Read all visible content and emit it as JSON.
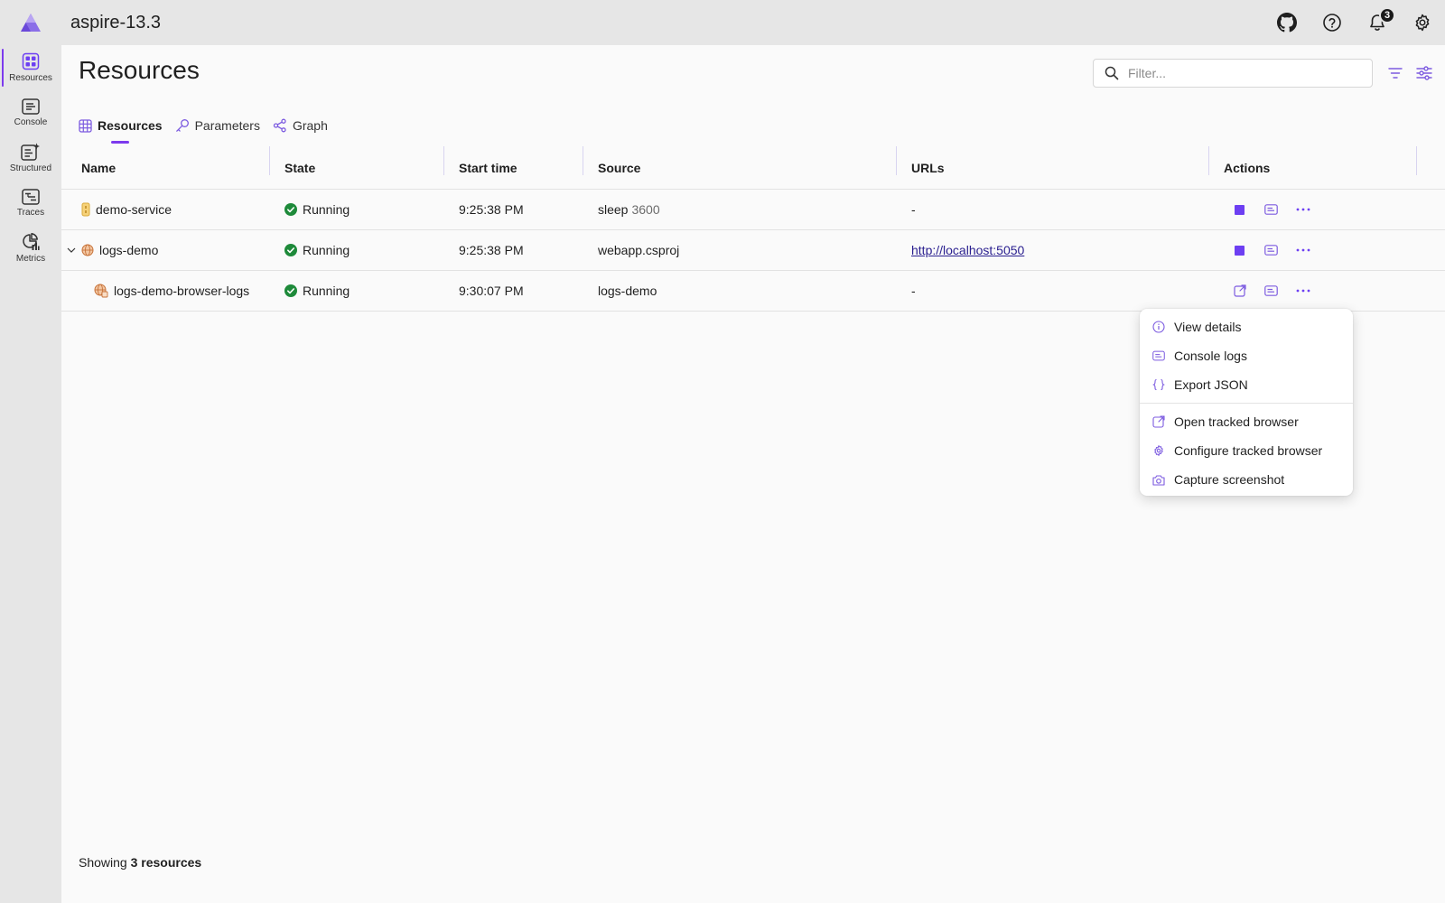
{
  "header": {
    "app_title": "aspire-13.3",
    "notification_count": "3"
  },
  "sidenav": {
    "items": [
      {
        "label": "Resources"
      },
      {
        "label": "Console"
      },
      {
        "label": "Structured"
      },
      {
        "label": "Traces"
      },
      {
        "label": "Metrics"
      }
    ]
  },
  "page": {
    "title": "Resources",
    "filter_placeholder": "Filter..."
  },
  "tabs": [
    {
      "label": "Resources"
    },
    {
      "label": "Parameters"
    },
    {
      "label": "Graph"
    }
  ],
  "table": {
    "headers": [
      "Name",
      "State",
      "Start time",
      "Source",
      "URLs",
      "Actions"
    ],
    "rows": [
      {
        "name": "demo-service",
        "state": "Running",
        "start": "9:25:38 PM",
        "source": "sleep",
        "source_arg": "3600",
        "url": "-"
      },
      {
        "name": "logs-demo",
        "state": "Running",
        "start": "9:25:38 PM",
        "source": "webapp.csproj",
        "source_arg": "",
        "url": "http://localhost:5050"
      },
      {
        "name": "logs-demo-browser-logs",
        "state": "Running",
        "start": "9:30:07 PM",
        "source": "logs-demo",
        "source_arg": "",
        "url": "-"
      }
    ]
  },
  "footer": {
    "prefix": "Showing",
    "count": "3 resources"
  },
  "menu": {
    "items": [
      {
        "label": "View details",
        "icon": "info-icon"
      },
      {
        "label": "Console logs",
        "icon": "console-icon"
      },
      {
        "label": "Export JSON",
        "icon": "braces-icon"
      },
      {
        "label": "Open tracked browser",
        "icon": "open-external-icon"
      },
      {
        "label": "Configure tracked browser",
        "icon": "gear-icon"
      },
      {
        "label": "Capture screenshot",
        "icon": "camera-icon"
      }
    ]
  },
  "colors": {
    "accent": "#7c3aed",
    "running": "#1e8a3a",
    "header_bg": "#e6e6e6"
  }
}
